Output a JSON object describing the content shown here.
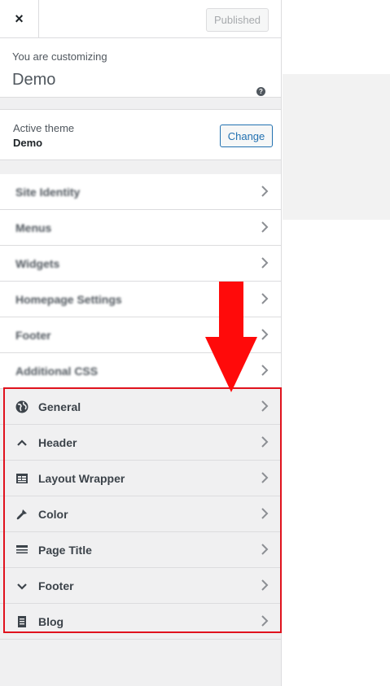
{
  "header": {
    "close_symbol": "×",
    "publish_label": "Published"
  },
  "info": {
    "subtitle": "You are customizing",
    "site_title": "Demo",
    "help_symbol": "?"
  },
  "theme": {
    "label": "Active theme",
    "name": "Demo",
    "change_label": "Change"
  },
  "core_sections": [
    "Site Identity",
    "Menus",
    "Widgets",
    "Homepage Settings",
    "Footer",
    "Additional CSS"
  ],
  "plugin_sections": [
    {
      "label": "General",
      "icon": "globe-icon"
    },
    {
      "label": "Header",
      "icon": "chevron-up-icon"
    },
    {
      "label": "Layout Wrapper",
      "icon": "layout-icon"
    },
    {
      "label": "Color",
      "icon": "paint-brush-icon"
    },
    {
      "label": "Page Title",
      "icon": "page-title-icon"
    },
    {
      "label": "Footer",
      "icon": "chevron-down-icon"
    },
    {
      "label": "Blog",
      "icon": "book-icon"
    }
  ],
  "colors": {
    "highlight": "#e0121d",
    "accent": "#2271b1"
  }
}
